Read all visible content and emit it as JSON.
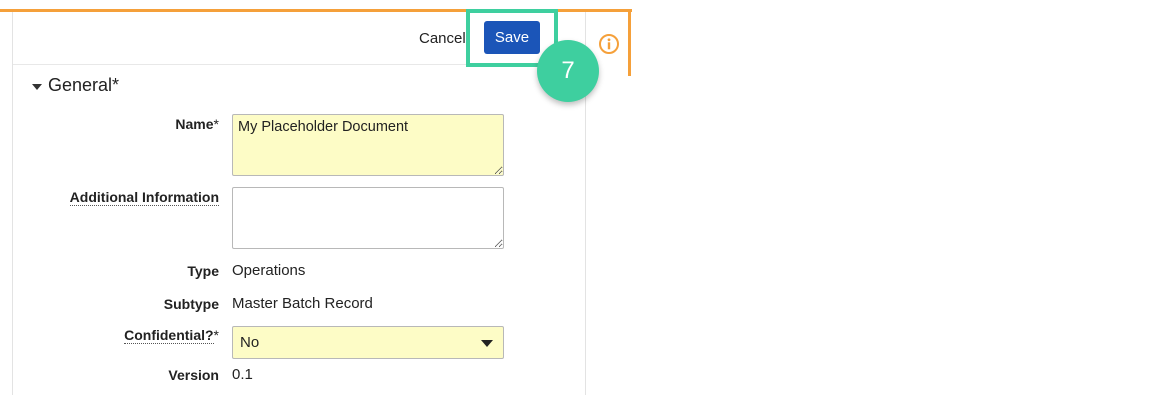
{
  "toolbar": {
    "cancel_label": "Cancel",
    "save_label": "Save"
  },
  "callout": {
    "step": "7"
  },
  "colors": {
    "accent_orange": "#f5a03a",
    "highlight_green": "#3ecf9f",
    "save_blue": "#1b55b8",
    "required_field_bg": "#fdfcc6"
  },
  "section": {
    "title": "General*"
  },
  "fields": {
    "name": {
      "label": "Name",
      "required_mark": "*",
      "value": "My Placeholder Document"
    },
    "additional_info": {
      "label": "Additional Information",
      "value": ""
    },
    "type": {
      "label": "Type",
      "value": "Operations"
    },
    "subtype": {
      "label": "Subtype",
      "value": "Master Batch Record"
    },
    "confidential": {
      "label": "Confidential?",
      "required_mark": "*",
      "value": "No"
    },
    "version": {
      "label": "Version",
      "value": "0.1"
    }
  },
  "icons": {
    "info": "info-circle-icon",
    "caret": "caret-down-icon",
    "select_arrow": "chevron-down-icon"
  }
}
